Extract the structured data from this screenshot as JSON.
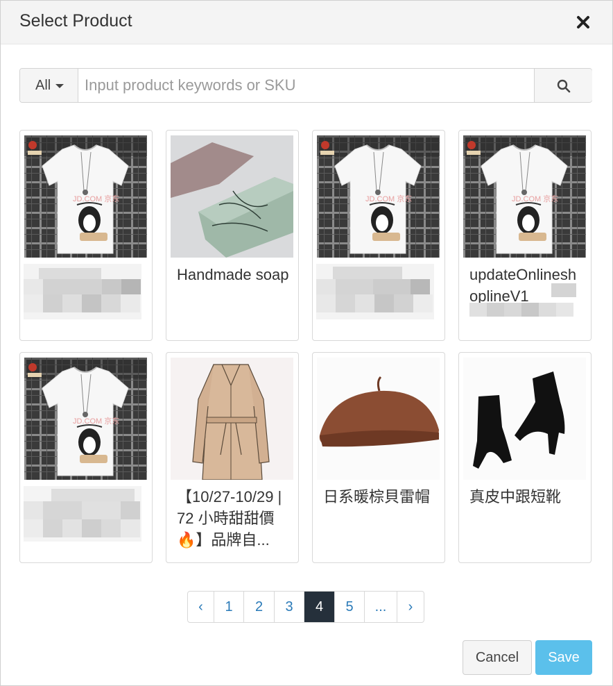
{
  "modal": {
    "title": "Select Product",
    "close_icon": "close-icon"
  },
  "search": {
    "filter_label": "All",
    "placeholder": "Input product keywords or SKU",
    "value": "",
    "search_icon": "search-icon"
  },
  "products": [
    {
      "name": "",
      "image": "white-tshirt-cat-print",
      "name_obscured": true
    },
    {
      "name": "Handmade soap",
      "image": "handmade-soap-bars",
      "name_obscured": false
    },
    {
      "name": "",
      "image": "white-tshirt-cat-print",
      "name_obscured": true
    },
    {
      "name": "updateOnlineshoplineV1",
      "image": "white-tshirt-cat-print",
      "name_obscured": true
    },
    {
      "name": "",
      "image": "white-tshirt-cat-print",
      "name_obscured": true
    },
    {
      "name": "【10/27-10/29 | 72 小時甜甜價🔥】品牌自...",
      "image": "beige-trench-coat",
      "name_obscured": false
    },
    {
      "name": "日系暖棕貝雷帽",
      "image": "brown-beret",
      "name_obscured": false
    },
    {
      "name": "真皮中跟短靴",
      "image": "black-ankle-boots",
      "name_obscured": false
    }
  ],
  "pagination": {
    "prev": "‹",
    "pages": [
      "1",
      "2",
      "3",
      "4",
      "5",
      "..."
    ],
    "current": "4",
    "next": "›"
  },
  "footer": {
    "cancel_label": "Cancel",
    "save_label": "Save"
  },
  "colors": {
    "primary": "#5bc0eb",
    "active_page": "#25303b",
    "link": "#2a7ab8"
  }
}
